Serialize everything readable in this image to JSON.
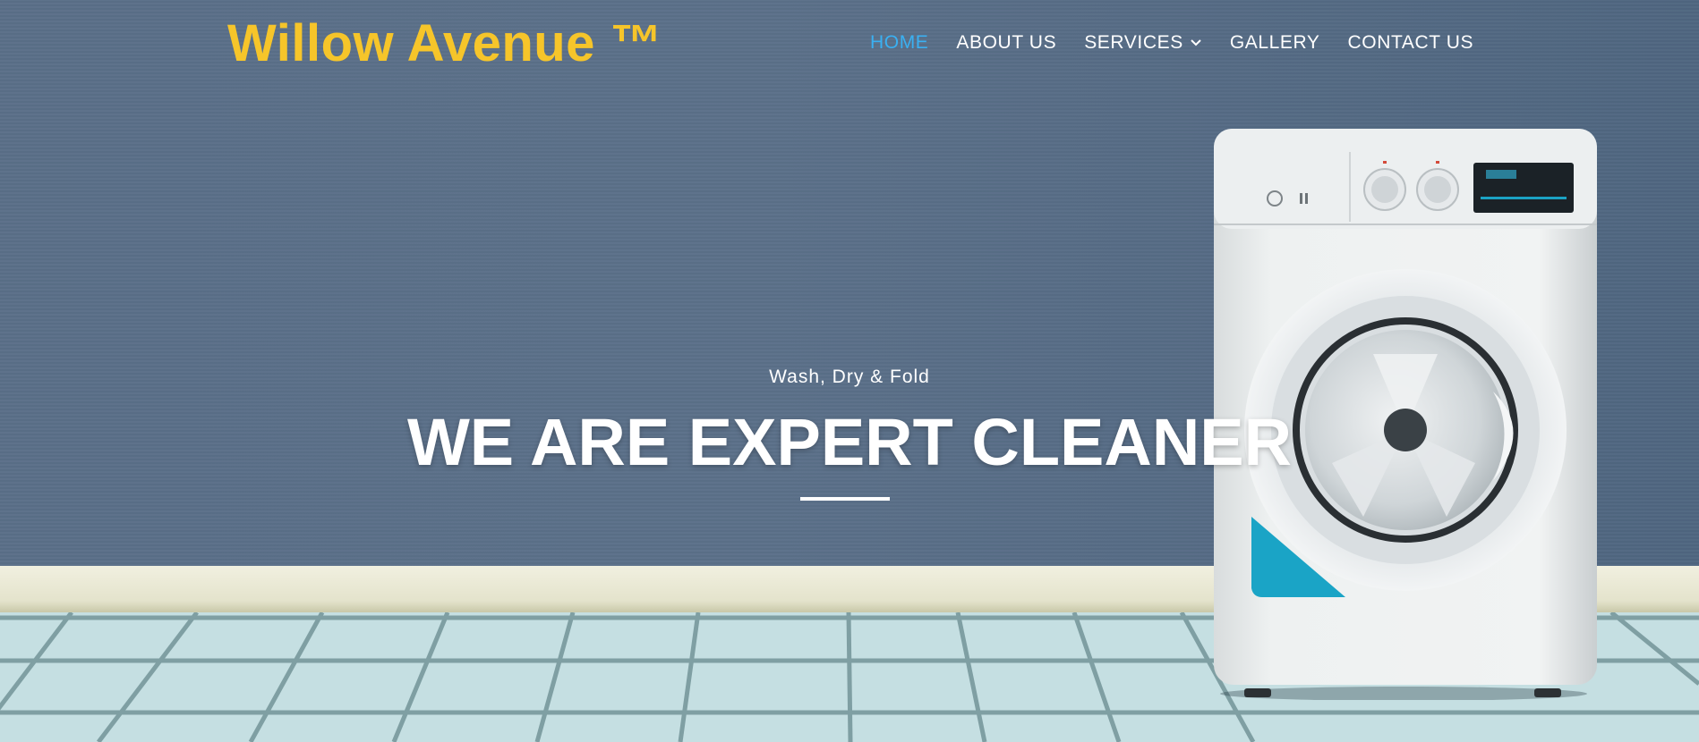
{
  "brand": {
    "logo_text": "Willow Avenue  ™",
    "color": "#f6c52a"
  },
  "nav": {
    "active_color": "#3ab0f2",
    "items": [
      {
        "label": "HOME",
        "active": true
      },
      {
        "label": "ABOUT US"
      },
      {
        "label": "SERVICES",
        "has_dropdown": true,
        "icon": "chevron-down-icon"
      },
      {
        "label": "GALLERY"
      },
      {
        "label": "CONTACT US"
      }
    ]
  },
  "hero": {
    "subtitle": "Wash, Dry & Fold",
    "title": "WE ARE EXPERT CLEANER",
    "background": "laundry room with washing machine on tiled floor"
  }
}
